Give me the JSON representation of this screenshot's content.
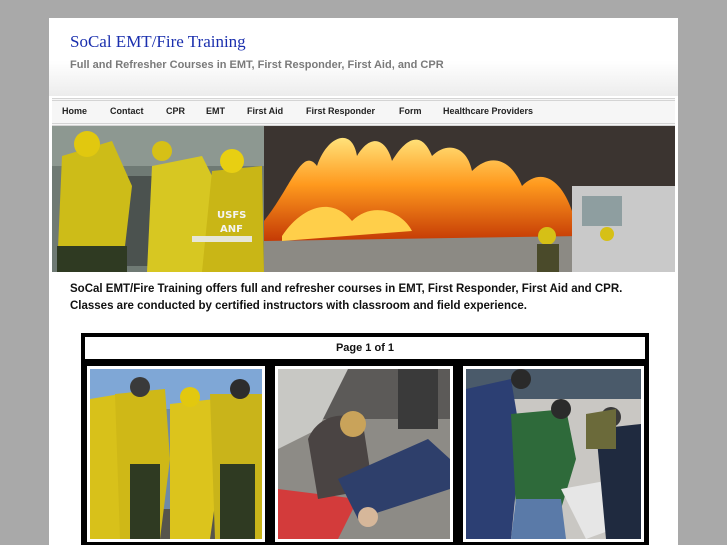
{
  "site": {
    "title": "SoCal EMT/Fire Training",
    "tagline": "Full and Refresher Courses in EMT, First Responder, First Aid, and CPR"
  },
  "nav": {
    "items": [
      "Home",
      "Contact",
      "CPR",
      "EMT",
      "First Aid",
      "First Responder",
      "Form",
      "Healthcare Providers"
    ]
  },
  "banner": {
    "uniform_marks": [
      "USFS",
      "ANF"
    ]
  },
  "intro": {
    "text": "SoCal EMT/Fire Training offers full and refresher courses in EMT, First Responder, First Aid and CPR. Classes are conducted by certified instructors with classroom and field experience."
  },
  "gallery": {
    "pager": "Page 1 of 1"
  },
  "colors": {
    "title_blue": "#1a2fae",
    "page_bg": "#a9a9a9",
    "gallery_bg": "#000000",
    "turnout_yellow": "#d9c31a"
  }
}
